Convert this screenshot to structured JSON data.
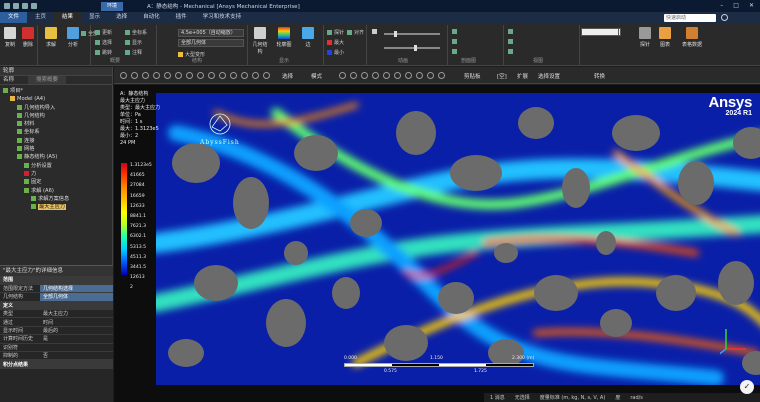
{
  "title_bar": {
    "context_tab": "环境",
    "title": "A：静态结构 - Mechanical [Ansys Mechanical Enterprise]",
    "win_min": "–",
    "win_max": "□",
    "win_close": "✕"
  },
  "menu": {
    "tabs": [
      "文件",
      "主页",
      "结果",
      "显示",
      "选择",
      "自动化",
      "插件",
      "学习和技术支持"
    ],
    "search_placeholder": "快速启动"
  },
  "ribbon": {
    "buttons": {
      "copy": "复制",
      "delete": "删除",
      "find": "求解",
      "analyze": "分析",
      "geometry": "几何结构",
      "contour": "轮廓图",
      "edge": "边",
      "probe": "探针",
      "chart": "图表",
      "animation": "动画",
      "table": "表格数据"
    },
    "small": [
      "全部",
      "更新",
      "选择",
      "跳转",
      "坐标系",
      "显示",
      "注释",
      "大小",
      "探针",
      "对齐",
      "最大",
      "最小",
      "标签"
    ],
    "scale_value": "4.5e+005（自动缩放）",
    "geometry_mode": "全部几何体",
    "result_label": "大型变形",
    "groups": [
      "概要",
      "结构",
      "显示",
      "动画",
      "剖面图",
      "视图",
      "标签"
    ]
  },
  "graphics_toolbar": {
    "select_label": "选择",
    "mode_label": "模式",
    "clip_label": "剪贴板",
    "empty_label": "[空]",
    "expand_label": "扩展",
    "select_assist": "选择设置",
    "convert_label": "转换"
  },
  "outline": {
    "header": "轮廓",
    "name_col": "名称",
    "search_placeholder": "搜索概要",
    "items": [
      {
        "label": "项目*",
        "level": 0,
        "color": "#6ab04c"
      },
      {
        "label": "Model (A4)",
        "level": 1,
        "color": "#e8b84a"
      },
      {
        "label": "几何结构导入",
        "level": 2,
        "color": "#6ab04c"
      },
      {
        "label": "几何结构",
        "level": 2,
        "color": "#6ab04c"
      },
      {
        "label": "材料",
        "level": 2,
        "color": "#6ab04c"
      },
      {
        "label": "坐标系",
        "level": 2,
        "color": "#6ab04c"
      },
      {
        "label": "连接",
        "level": 2,
        "color": "#6ab04c"
      },
      {
        "label": "网格",
        "level": 2,
        "color": "#6ab04c"
      },
      {
        "label": "静态结构 (A5)",
        "level": 2,
        "color": "#6ab04c"
      },
      {
        "label": "分析设置",
        "level": 3,
        "color": "#6ab04c"
      },
      {
        "label": "力",
        "level": 3,
        "color": "#c23"
      },
      {
        "label": "固定",
        "level": 3,
        "color": "#6ab04c"
      },
      {
        "label": "求解 (A6)",
        "level": 3,
        "color": "#6ab04c"
      },
      {
        "label": "求解方案信息",
        "level": 4,
        "color": "#6ab04c"
      },
      {
        "label": "最大主应力",
        "level": 4,
        "color": "#6ab04c"
      }
    ]
  },
  "details": {
    "header": "\"最大主应力\"的详细信息",
    "rows": [
      {
        "type": "sec",
        "k": "范围"
      },
      {
        "k": "范围限定方法",
        "v": "几何结构选择",
        "blue": true
      },
      {
        "k": "几何结构",
        "v": "全部几何体",
        "blue": true
      },
      {
        "type": "sec",
        "k": "定义"
      },
      {
        "k": "类型",
        "v": "最大主应力"
      },
      {
        "k": "通过",
        "v": "时间"
      },
      {
        "k": "显示时间",
        "v": "最后的"
      },
      {
        "k": "计算时间历史",
        "v": "是"
      },
      {
        "k": "识别符",
        "v": ""
      },
      {
        "k": "抑制的",
        "v": "否"
      },
      {
        "type": "sec",
        "k": "积分点结果"
      }
    ]
  },
  "view": {
    "info": [
      "A：静态结构",
      "最大主应力",
      "类型：最大主应力",
      "单位：Pa",
      "时间：1 s",
      "最大：1.3123e5",
      "最小：2",
      "24 PM"
    ],
    "legend_values": [
      "1.3123e5",
      "41665",
      "27084",
      "16659",
      "12633",
      "8841.1",
      "7621.3",
      "6302.1",
      "5313.5",
      "4511.3",
      "3441.5",
      "12613",
      "2"
    ],
    "logo": "Ansys",
    "version": "2024 R1",
    "watermark": "AbyssFish",
    "scale_labels": [
      "0.000",
      "1.150",
      "2.300 (m)",
      "0.575",
      "1.725"
    ]
  },
  "status": {
    "messages": "1 消息",
    "selection": "无选择",
    "metric": "度量标准 (m, kg, N, s, V, A)",
    "angle": "度",
    "rads": "rad/s"
  },
  "colors": {
    "accent": "#2d5e9e",
    "titlebar": "#0b1a30",
    "background": "#2a2a2a"
  }
}
